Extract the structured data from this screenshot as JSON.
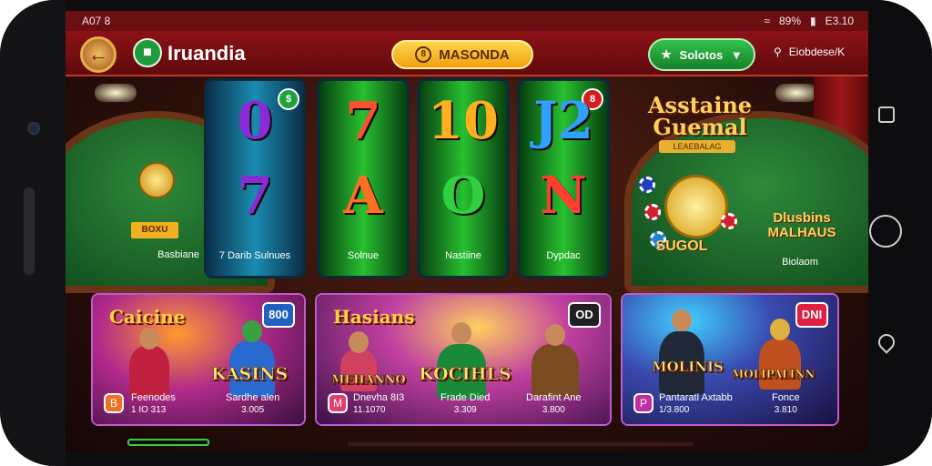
{
  "status_bar": {
    "time": "A07 8",
    "battery": "89%",
    "network": "E3.10"
  },
  "header": {
    "back_symbol": "←",
    "logo_glyph": "■",
    "app_title": "Iruandia",
    "promo_label": "MASONDA",
    "promo_icon": "8",
    "solution_label": "Solotos",
    "solution_icon_left": "★",
    "solution_icon_right": "▼",
    "search_label": "Eiobdese/K"
  },
  "feature_left": {
    "sign": "BOXU",
    "label": "Basbiane"
  },
  "reels": [
    {
      "top": "0",
      "bottom": "7",
      "label": "7 Darib Sulnues",
      "badge": "$",
      "top_color": "#8a2ad8",
      "bottom_color": "#8a2ad8"
    },
    {
      "top": "7",
      "bottom": "A",
      "label": "Solnue",
      "badge": "",
      "top_color": "#ff5030",
      "bottom_color": "#ff7020"
    },
    {
      "top": "10",
      "bottom": "O",
      "label": "Nastiine",
      "badge": "",
      "top_color": "#ffb020",
      "bottom_color": "#30d040"
    },
    {
      "top": "J2",
      "bottom": "N",
      "label": "Dypdac",
      "badge": "8",
      "top_color": "#30a0ff",
      "bottom_color": "#ff4030"
    }
  ],
  "feature_right": {
    "title": "Asstaine Guemal",
    "ribbon": "LEAEBALAG",
    "gold_label": "SUGOL",
    "mega_label": "Dlusbins MALHAUS",
    "label": "Biolaom"
  },
  "cards": [
    {
      "title": "Caicine",
      "main": "KASINS",
      "badge": "800",
      "badge_color": "#2060c0",
      "icon": "B",
      "col1_label": "Feenodes",
      "col1_value": "1 IO 313",
      "col2_label": "Sardhe alen",
      "col2_value": "3.005"
    },
    {
      "title": "Hasians",
      "main": "KOCIHLS",
      "badge": "OD",
      "badge_color": "#202020",
      "icon": "M",
      "extra": "MEHANNO",
      "col1_label": "Dnevha 8I3",
      "col1_value": "11.1070",
      "col2_label": "Frade Died",
      "col2_value": "3.309",
      "col3_label": "Darafint Ane",
      "col3_value": "3.800"
    },
    {
      "title": "",
      "main": "MOLINIS",
      "badge": "DNI",
      "badge_color": "#e02040",
      "icon": "P",
      "extra": "MOLIPALINN",
      "col1_label": "Pantaratl Axtabb",
      "col1_value": "1/3.800",
      "col2_label": "Fonce",
      "col2_value": "3.810"
    }
  ]
}
